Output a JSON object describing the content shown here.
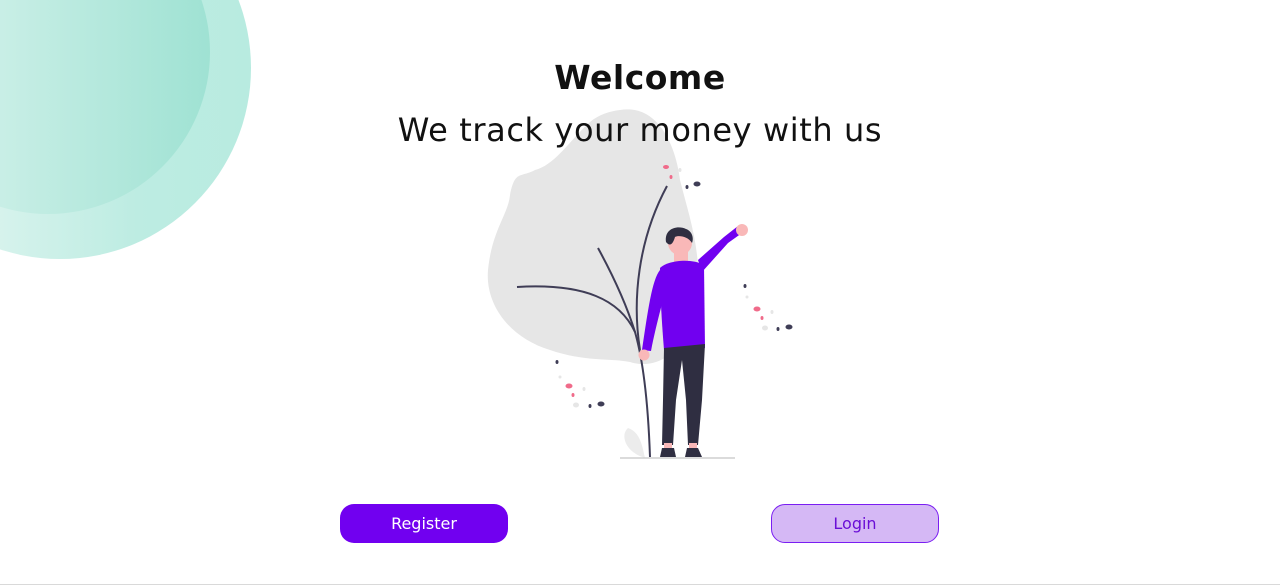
{
  "welcome": {
    "title": "Welcome",
    "subtitle": "We track your money with us"
  },
  "actions": {
    "register_label": "Register",
    "login_label": "Login"
  },
  "illustration": {
    "icon": "person-waving-illustration"
  },
  "colors": {
    "primary": "#7100f0",
    "secondary_fill": "#d5b8f5",
    "secondary_text": "#6a0ed6",
    "accent_teal": "#8edfcf",
    "leaf_gray": "#e6e6e6",
    "accent_pink": "#f06b8a"
  }
}
